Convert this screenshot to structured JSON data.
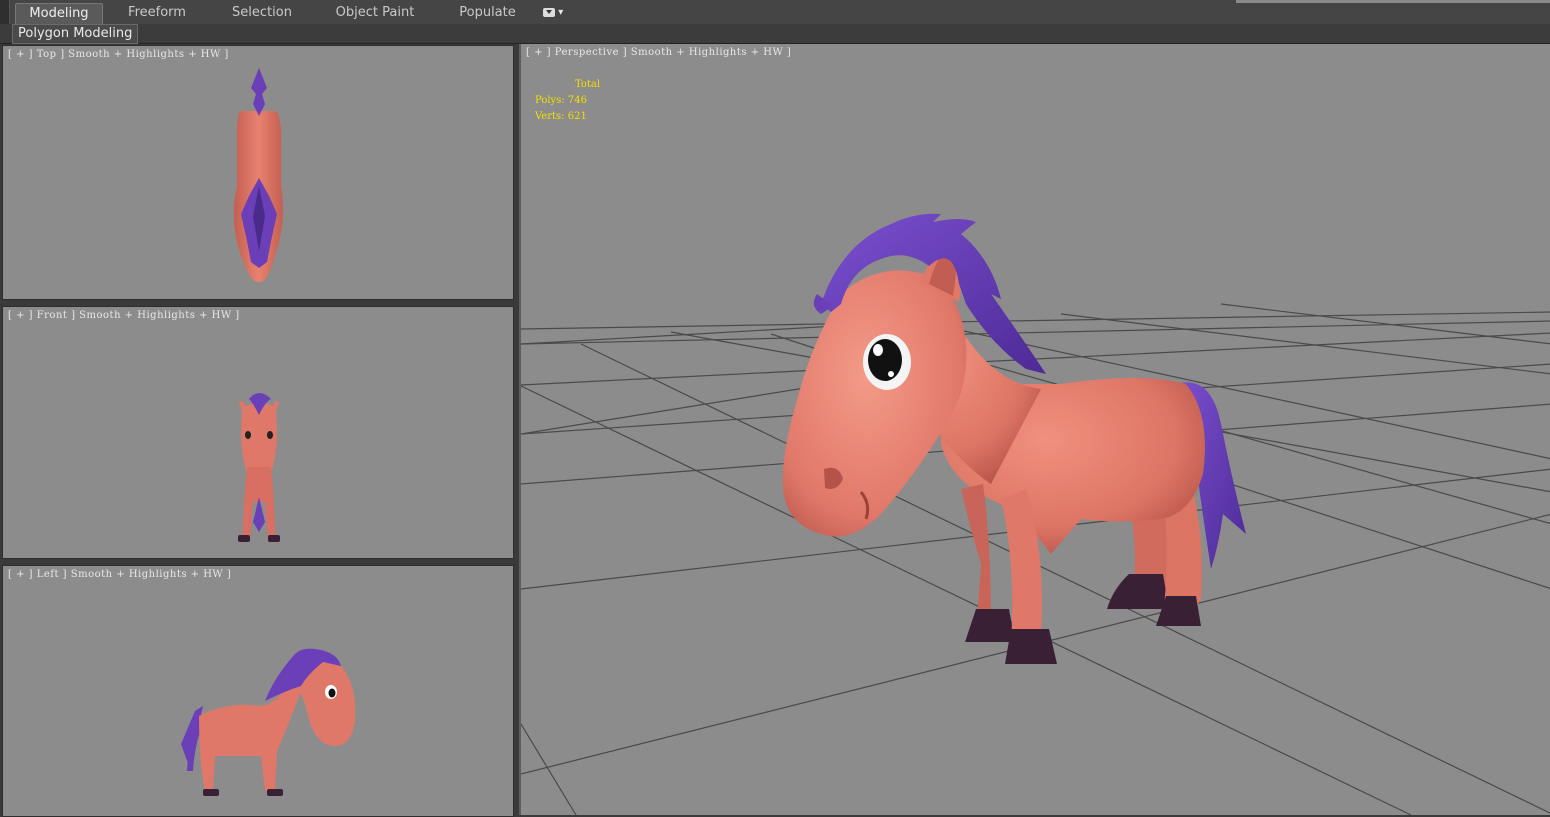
{
  "ribbon": {
    "tabs": [
      {
        "label": "Modeling",
        "active": true
      },
      {
        "label": "Freeform",
        "active": false
      },
      {
        "label": "Selection",
        "active": false
      },
      {
        "label": "Object Paint",
        "active": false
      },
      {
        "label": "Populate",
        "active": false
      }
    ],
    "panel_label": "Polygon Modeling"
  },
  "viewports": {
    "top": {
      "label": "[ + ] Top ] Smooth + Highlights + HW ]"
    },
    "front": {
      "label": "[ + ] Front ] Smooth + Highlights + HW ]"
    },
    "left": {
      "label": "[ + ] Left ] Smooth + Highlights + HW ]"
    },
    "perspective": {
      "label": "[ + ] Perspective ] Smooth + Highlights + HW ]",
      "stats": {
        "header": "Total",
        "polys_label": "Polys:",
        "polys": "746",
        "verts_label": "Verts:",
        "verts": "621"
      }
    }
  },
  "colors": {
    "viewport_bg": "#8c8c8c",
    "body": "#e0786a",
    "mane": "#6a3fb8",
    "hoof": "#3a2035",
    "stats_text": "#f0e000"
  }
}
